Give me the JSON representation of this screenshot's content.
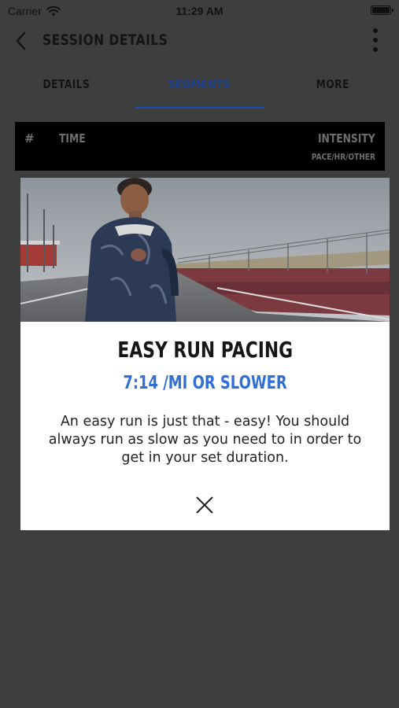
{
  "status_bar": {
    "carrier": "Carrier",
    "time": "11:29 AM"
  },
  "nav": {
    "title": "SESSION DETAILS",
    "back_icon": "chevron-left-icon",
    "more_icon": "more-vertical-icon"
  },
  "tabs": [
    {
      "label": "DETAILS",
      "active": false
    },
    {
      "label": "SEGMENTS",
      "active": true
    },
    {
      "label": "MORE",
      "active": false
    }
  ],
  "table": {
    "col_num": "#",
    "col_time": "TIME",
    "col_intensity": "INTENSITY",
    "col_intensity_sub": "PACE/HR/OTHER"
  },
  "modal": {
    "title": "EASY RUN PACING",
    "pace": "7:14 /MI OR SLOWER",
    "body": "An easy run is just that - easy! You should always run as slow as you need to in order to get in your set duration.",
    "close_icon": "close-icon"
  },
  "colors": {
    "accent": "#2f6fd6",
    "tab_active": "#1a3e8a",
    "overlay": "#3e3e3e"
  }
}
